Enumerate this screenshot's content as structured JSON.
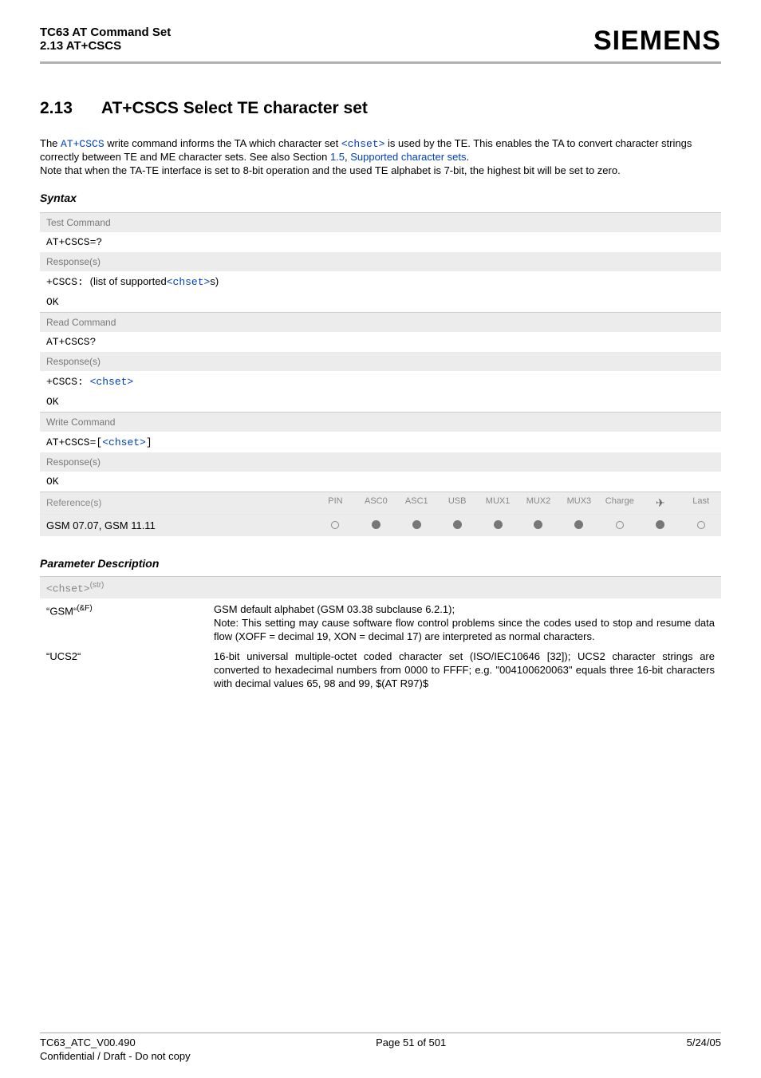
{
  "header": {
    "line1": "TC63 AT Command Set",
    "line2": "2.13 AT+CSCS",
    "brand": "SIEMENS"
  },
  "section": {
    "number": "2.13",
    "title": "AT+CSCS   Select TE character set"
  },
  "intro": {
    "prefix": "The ",
    "cmd1": "AT+CSCS",
    "mid1": " write command informs the TA which character set ",
    "param1": "<chset>",
    "mid2": " is used by the TE. This enables the TA to convert character strings correctly between TE and ME character sets. See also Section ",
    "secref": "1.5",
    "comma": ", ",
    "link2": "Supported character sets",
    "period": ".",
    "line2": "Note that when the TA-TE interface is set to 8-bit operation and the used TE alphabet is 7-bit, the highest bit will be set to zero."
  },
  "syntax_label": "Syntax",
  "syntax": {
    "test": {
      "label": "Test Command",
      "cmd": "AT+CSCS=?",
      "resp_label": "Response(s)",
      "resp_prefix": "+CSCS: ",
      "resp_text": "(list of supported",
      "resp_param": "<chset>",
      "resp_suffix": "s)",
      "ok": "OK"
    },
    "read": {
      "label": "Read Command",
      "cmd": "AT+CSCS?",
      "resp_label": "Response(s)",
      "resp_prefix": "+CSCS: ",
      "resp_param": "<chset>",
      "ok": "OK"
    },
    "write": {
      "label": "Write Command",
      "cmd_prefix": "AT+CSCS=",
      "cmd_open": "[",
      "cmd_param": "<chset>",
      "cmd_close": "]",
      "resp_label": "Response(s)",
      "ok": "OK"
    }
  },
  "ref": {
    "label": "Reference(s)",
    "value_line": "GSM 07.07, GSM 11.11",
    "cols": [
      "PIN",
      "ASC0",
      "ASC1",
      "USB",
      "MUX1",
      "MUX2",
      "MUX3",
      "Charge",
      "✈",
      "Last"
    ],
    "vals": [
      "open",
      "fill",
      "fill",
      "fill",
      "fill",
      "fill",
      "fill",
      "open",
      "fill",
      "open"
    ]
  },
  "param_label": "Parameter Description",
  "param_header": {
    "name": "<chset>",
    "sup": "(str)"
  },
  "params": [
    {
      "key_prefix": "“GSM“",
      "key_sup": "(&F)",
      "val": "GSM default alphabet (GSM 03.38 subclause 6.2.1);\nNote: This setting may cause software flow control problems since the codes used to stop and resume data flow (XOFF = decimal 19, XON = decimal 17) are interpreted as normal characters."
    },
    {
      "key_prefix": "“UCS2“",
      "key_sup": "",
      "val": "16-bit universal multiple-octet coded character set (ISO/IEC10646 [32]); UCS2 character strings are converted to hexadecimal numbers from 0000 to FFFF; e.g. \"004100620063\" equals three 16-bit characters with decimal values 65, 98 and 99, $(AT R97)$"
    }
  ],
  "footer": {
    "left": "TC63_ATC_V00.490",
    "center": "Page 51 of 501",
    "right": "5/24/05",
    "second": "Confidential / Draft - Do not copy"
  }
}
